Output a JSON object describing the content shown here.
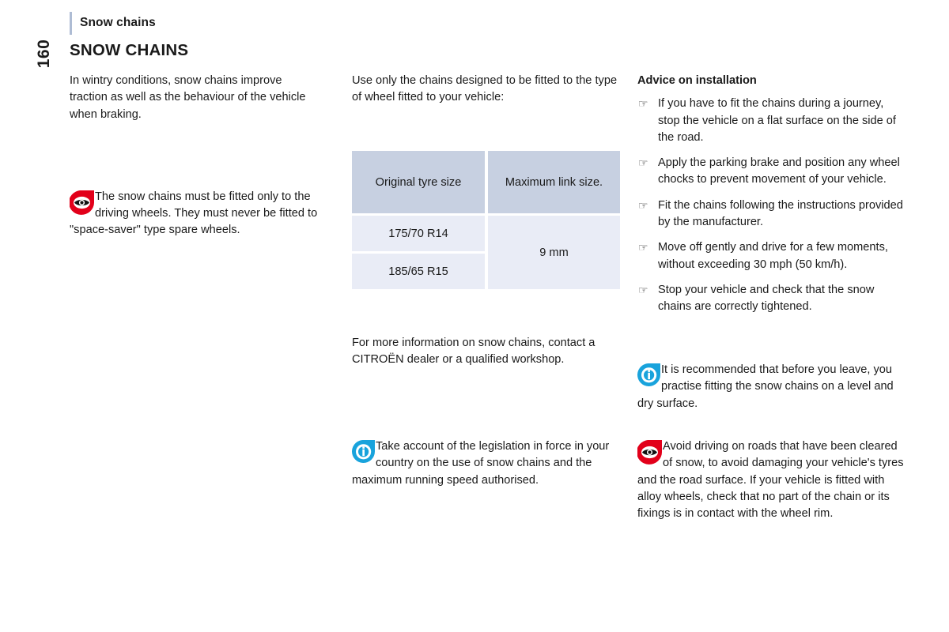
{
  "page": {
    "folio": "160",
    "running_header": "Snow chains",
    "section_title": "SNOW CHAINS",
    "accent_bar_color": "#aebcd4",
    "warning_icon_color": "#e2001a",
    "info_icon_color": "#009ddc",
    "table_header_color": "#c7d0e1",
    "table_body_color": "#e9ecf6"
  },
  "left_column": {
    "intro_paragraph": "In wintry conditions, snow chains improve traction as well as the behaviour of the vehicle when braking.",
    "warning": {
      "icon": "warning-eye-icon",
      "text": "The snow chains must be fitted only to the driving wheels. They must never be fitted to \"space-saver\" type spare wheels."
    }
  },
  "middle_column": {
    "intro_paragraph": "Use only the chains designed to be fitted to the type of wheel fitted to your vehicle:",
    "table": {
      "headers": [
        "Original tyre size",
        "Maximum link size."
      ],
      "rows": [
        {
          "tyre_size": "175/70 R14"
        },
        {
          "tyre_size": "185/65 R15"
        }
      ],
      "merged_value": "9 mm"
    },
    "more_info_paragraph": "For more information on snow chains, contact a CITROËN dealer or a qualified workshop.",
    "note": {
      "icon": "info-icon",
      "text": "Take account of the legislation in force in your country on the use of snow chains and the maximum running speed authorised."
    }
  },
  "right_column": {
    "advice_title": "Advice on installation",
    "advice_items": [
      {
        "marker": "pointing-hand-icon",
        "text": "If you have to fit the chains during a journey, stop the vehicle on a flat surface on the side of the road."
      },
      {
        "marker": "pointing-hand-icon",
        "text": "Apply the parking brake and position any wheel chocks to prevent movement of your vehicle."
      },
      {
        "marker": "pointing-hand-icon",
        "text": "Fit the chains following the instructions provided by the manufacturer."
      },
      {
        "marker": "pointing-hand-icon",
        "text": "Move off gently and drive for a few moments, without exceeding 30 mph (50 km/h)."
      },
      {
        "marker": "pointing-hand-icon",
        "text": "Stop your vehicle and check that the snow chains are correctly tightened."
      }
    ],
    "note": {
      "icon": "info-icon",
      "text": "It is recommended that before you leave, you practise fitting the snow chains on a level and dry surface."
    },
    "warning": {
      "icon": "warning-eye-icon",
      "text": "Avoid driving on roads that have been cleared of snow, to avoid damaging your vehicle's tyres and the road surface. If your vehicle is fitted with alloy wheels, check that no part of the chain or its fixings is in contact with the wheel rim."
    }
  },
  "icons": {
    "pointing_hand_glyph": "☞"
  }
}
